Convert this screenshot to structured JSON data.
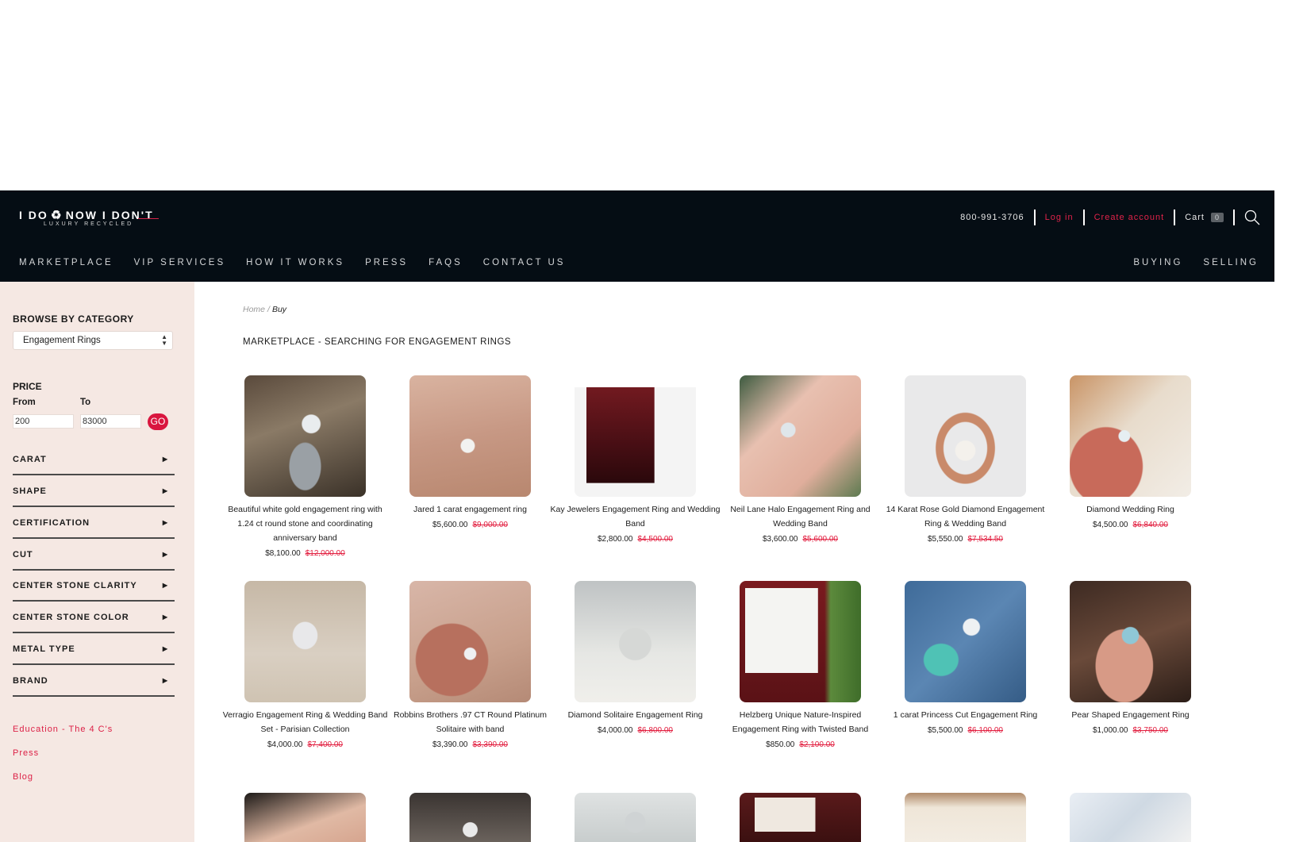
{
  "header": {
    "logo_main_left": "I DO",
    "logo_main_right": "NOW I DON'T",
    "logo_sub": "LUXURY RECYCLED",
    "phone": "800-991-3706",
    "login": "Log in",
    "create_account": "Create account",
    "cart_label": "Cart",
    "cart_count": "0",
    "nav": [
      "MARKETPLACE",
      "VIP SERVICES",
      "HOW IT WORKS",
      "PRESS",
      "FAQS",
      "CONTACT US"
    ],
    "right_nav": [
      "BUYING",
      "SELLING"
    ]
  },
  "sidebar": {
    "browse_title": "BROWSE BY CATEGORY",
    "category_selected": "Engagement Rings",
    "price_label": "PRICE",
    "from_label": "From",
    "to_label": "To",
    "from_value": "200",
    "to_value": "83000",
    "go_label": "GO",
    "filters": [
      "CARAT",
      "SHAPE",
      "CERTIFICATION",
      "CUT",
      "CENTER STONE CLARITY",
      "CENTER STONE COLOR",
      "METAL TYPE",
      "BRAND"
    ],
    "links": [
      "Education - The 4 C's",
      "Press",
      "Blog"
    ]
  },
  "breadcrumb": {
    "home": "Home",
    "sep": "/",
    "current": "Buy"
  },
  "page_title": "MARKETPLACE - SEARCHING FOR ENGAGEMENT RINGS",
  "products": [
    {
      "title": "Beautiful white gold engagement ring with 1.24 ct round stone and coordinating anniversary band",
      "price": "$8,100.00",
      "old_price": "$12,000.00"
    },
    {
      "title": "Jared 1 carat engagement ring",
      "price": "$5,600.00",
      "old_price": "$9,000.00"
    },
    {
      "title": "Kay Jewelers Engagement Ring and Wedding Band",
      "price": "$2,800.00",
      "old_price": "$4,500.00"
    },
    {
      "title": "Neil Lane Halo Engagement Ring and Wedding Band",
      "price": "$3,600.00",
      "old_price": "$5,600.00"
    },
    {
      "title": "14 Karat Rose Gold Diamond Engagement Ring & Wedding Band",
      "price": "$5,550.00",
      "old_price": "$7,534.50"
    },
    {
      "title": "Diamond Wedding Ring",
      "price": "$4,500.00",
      "old_price": "$6,840.00"
    },
    {
      "title": "Verragio Engagement Ring & Wedding Band Set - Parisian Collection",
      "price": "$4,000.00",
      "old_price": "$7,400.00"
    },
    {
      "title": "Robbins Brothers .97 CT Round Platinum Solitaire with band",
      "price": "$3,390.00",
      "old_price": "$3,390.00"
    },
    {
      "title": "Diamond Solitaire Engagement Ring",
      "price": "$4,000.00",
      "old_price": "$6,800.00"
    },
    {
      "title": "Helzberg Unique Nature-Inspired Engagement Ring with Twisted Band",
      "price": "$850.00",
      "old_price": "$2,100.00"
    },
    {
      "title": "1 carat Princess Cut Engagement Ring",
      "price": "$5,500.00",
      "old_price": "$6,100.00"
    },
    {
      "title": "Pear Shaped Engagement Ring",
      "price": "$1,000.00",
      "old_price": "$3,750.00"
    }
  ],
  "colors": {
    "header_bg": "#050d14",
    "accent_red": "#d9163f",
    "sidebar_bg": "#f5e8e3"
  }
}
